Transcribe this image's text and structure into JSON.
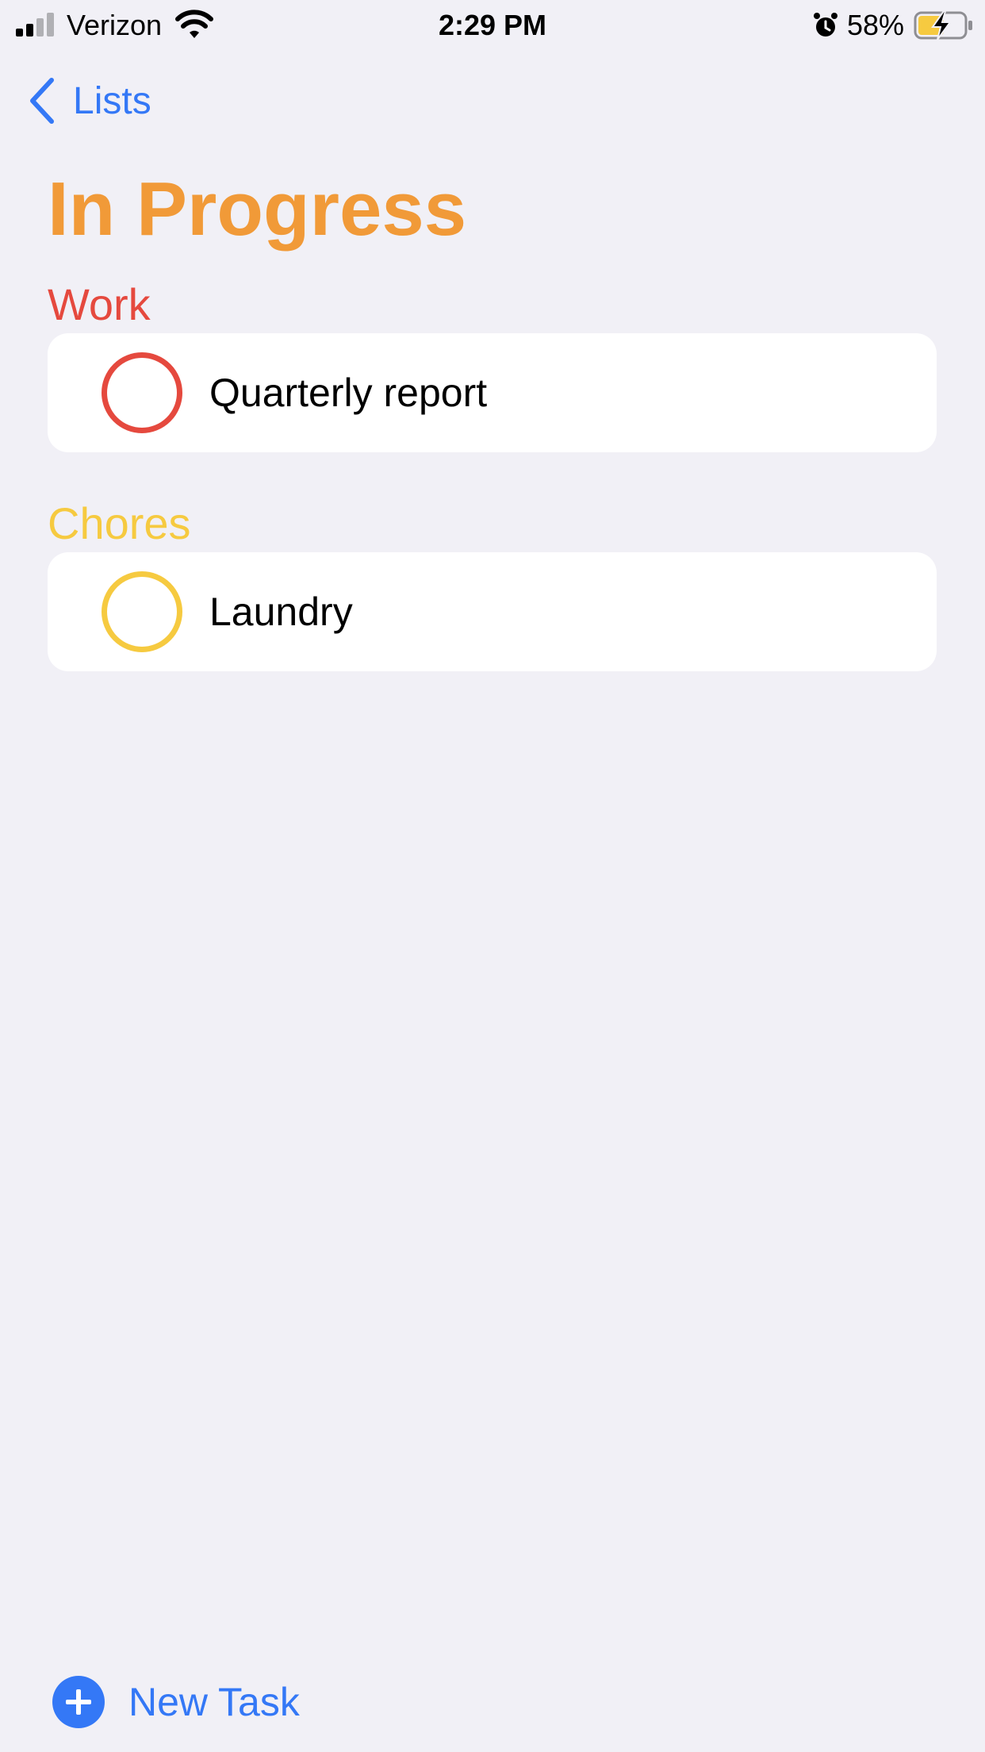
{
  "status_bar": {
    "carrier": "Verizon",
    "time": "2:29 PM",
    "battery_percent": "58%",
    "battery_level": 0.58,
    "signal_bars": 2,
    "icons": [
      "signal-icon",
      "wifi-icon",
      "alarm-icon",
      "battery-charging-icon"
    ]
  },
  "nav": {
    "back_label": "Lists",
    "back_icon": "chevron-left-icon"
  },
  "title": "In Progress",
  "colors": {
    "title": "#f19a38",
    "accent": "#3478f6",
    "work": "#e5493e",
    "chores": "#f6ca40",
    "background": "#f1f0f6"
  },
  "sections": [
    {
      "name": "Work",
      "color": "#e5493e",
      "tasks": [
        {
          "title": "Quarterly report",
          "completed": false
        }
      ]
    },
    {
      "name": "Chores",
      "color": "#f6ca40",
      "tasks": [
        {
          "title": "Laundry",
          "completed": false
        }
      ]
    }
  ],
  "footer": {
    "new_task_label": "New Task",
    "new_task_icon": "plus-circle-icon"
  }
}
